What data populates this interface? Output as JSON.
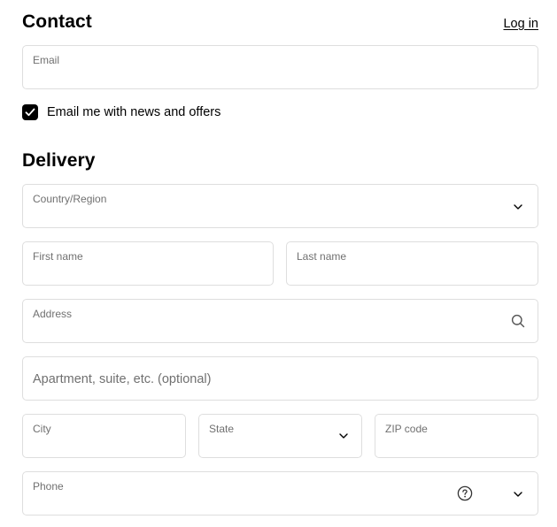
{
  "contact": {
    "heading": "Contact",
    "login_link": "Log in",
    "email": {
      "label": "Email",
      "value": ""
    },
    "newsletter": {
      "label": "Email me with news and offers",
      "checked": true
    }
  },
  "delivery": {
    "heading": "Delivery",
    "country": {
      "label": "Country/Region",
      "value": ""
    },
    "first_name": {
      "label": "First name",
      "value": ""
    },
    "last_name": {
      "label": "Last name",
      "value": ""
    },
    "address": {
      "label": "Address",
      "value": ""
    },
    "apartment": {
      "placeholder": "Apartment, suite, etc. (optional)"
    },
    "city": {
      "label": "City",
      "value": ""
    },
    "state": {
      "label": "State",
      "value": ""
    },
    "zip": {
      "label": "ZIP code",
      "value": ""
    },
    "phone": {
      "label": "Phone",
      "value": ""
    }
  },
  "icons": {
    "select_chevron": "chevron-down-icon",
    "address_search": "search-icon",
    "phone_help": "help-circle-icon"
  },
  "colors": {
    "text": "#000000",
    "label": "#707070",
    "border": "#dedede",
    "checkbox_fill": "#000000"
  }
}
